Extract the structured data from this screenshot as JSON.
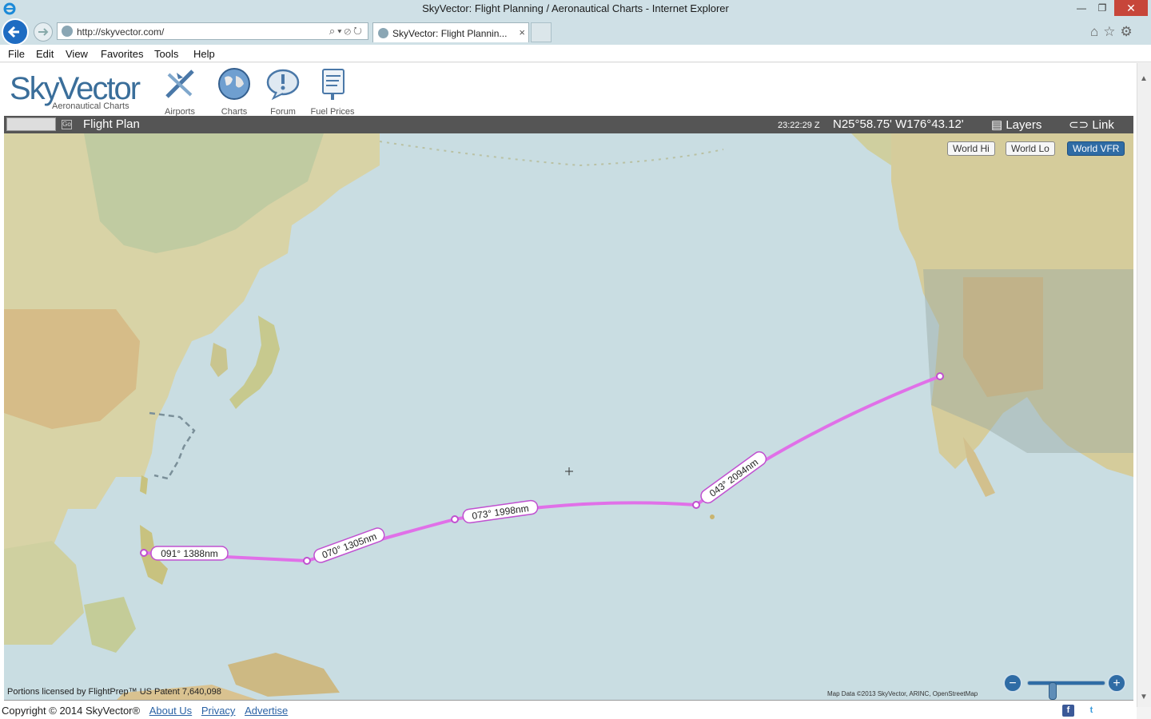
{
  "browser": {
    "window_title": "SkyVector: Flight Planning / Aeronautical Charts - Internet Explorer",
    "url": "http://skyvector.com/",
    "tab_title": "SkyVector: Flight Plannin...",
    "tab_close": "×",
    "window_buttons": {
      "minimize": "—",
      "maximize": "❐",
      "close": "✕"
    },
    "right_icons": "⌂☆⚙"
  },
  "menu": [
    "File",
    "Edit",
    "View",
    "Favorites",
    "Tools",
    "Help"
  ],
  "site": {
    "logo_text": "SkyVector",
    "logo_subtitle": "Aeronautical Charts",
    "nav": [
      {
        "label": "Airports",
        "icon": "airport-icon"
      },
      {
        "label": "Charts",
        "icon": "globe-icon"
      },
      {
        "label": "Forum",
        "icon": "forum-icon"
      },
      {
        "label": "Fuel Prices",
        "icon": "fuel-sign-icon"
      }
    ]
  },
  "flight_bar": {
    "input_value": "",
    "go_label": "Go",
    "title": "Flight Plan",
    "utc_time": "23:22:29 Z",
    "coordinates": "N25°58.75' W176°43.12'",
    "layers_label": "Layers",
    "link_label": "Link"
  },
  "chart_buttons": [
    {
      "label": "World Hi",
      "active": false
    },
    {
      "label": "World Lo",
      "active": false
    },
    {
      "label": "World VFR",
      "active": true
    }
  ],
  "route_legs": [
    {
      "label": "091° 1388nm"
    },
    {
      "label": "070° 1305nm"
    },
    {
      "label": "073° 1998nm"
    },
    {
      "label": "043° 2094nm"
    }
  ],
  "map_texts": {
    "license": "Portions licensed by FlightPrep™ US Patent 7,640,098",
    "map_data": "Map Data ©2013 SkyVector, ARINC, OpenStreetMap"
  },
  "zoom": {
    "minus": "−",
    "plus": "+",
    "level": 0.3
  },
  "footer": {
    "copyright": "Copyright © 2014 SkyVector®",
    "links": [
      "About Us",
      "Privacy",
      "Advertise"
    ]
  },
  "colors": {
    "route": "#e070e8",
    "ocean": "#c9dde2",
    "land": "#d9cfa0",
    "accent": "#2f6ca5"
  }
}
